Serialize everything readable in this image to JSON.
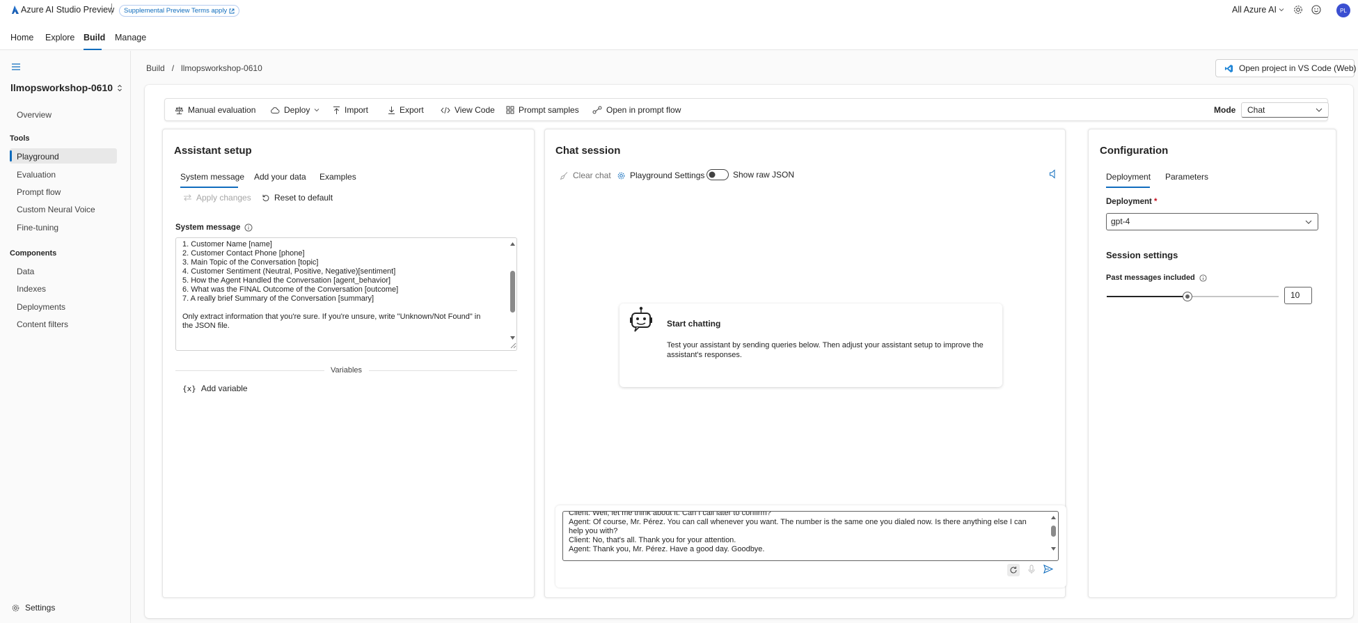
{
  "app": {
    "title": "Azure AI Studio Preview",
    "terms_badge": "Supplemental Preview Terms apply",
    "scope_selector": "All Azure AI",
    "avatar_initials": "PL",
    "accent_color": "#0f6cbd"
  },
  "nav": {
    "tabs": [
      "Home",
      "Explore",
      "Build",
      "Manage"
    ],
    "active": "Build"
  },
  "sidebar": {
    "project": "llmopsworkshop-0610",
    "overview": "Overview",
    "tools_heading": "Tools",
    "tools": [
      "Playground",
      "Evaluation",
      "Prompt flow",
      "Custom Neural Voice",
      "Fine-tuning"
    ],
    "components_heading": "Components",
    "components": [
      "Data",
      "Indexes",
      "Deployments",
      "Content filters"
    ],
    "settings": "Settings",
    "active": "Playground"
  },
  "breadcrumb": {
    "items": [
      "Build",
      "llmopsworkshop-0610"
    ],
    "separator": "/"
  },
  "header_actions": {
    "open_vscode": "Open project in VS Code (Web)"
  },
  "toolbar": {
    "manual_evaluation": "Manual evaluation",
    "deploy": "Deploy",
    "import": "Import",
    "export": "Export",
    "view_code": "View Code",
    "prompt_samples": "Prompt samples",
    "open_prompt_flow": "Open in prompt flow",
    "mode_label": "Mode",
    "mode_value": "Chat"
  },
  "assistant": {
    "title": "Assistant setup",
    "tabs": [
      "System message",
      "Add your data",
      "Examples"
    ],
    "active_tab": "System message",
    "apply_changes": "Apply changes",
    "reset_default": "Reset to default",
    "system_message_label": "System message",
    "system_message_lines": [
      "1. Customer Name [name]",
      "2. Customer Contact Phone [phone]",
      "3. Main Topic of the Conversation [topic]",
      "4. Customer Sentiment (Neutral, Positive, Negative)[sentiment]",
      "5. How the Agent Handled the Conversation [agent_behavior]",
      "6. What was the FINAL Outcome of the Conversation [outcome]",
      "7. A really brief Summary of the Conversation [summary]",
      "",
      "Only extract information that you're sure. If you're unsure, write \"Unknown/Not Found\" in",
      "the JSON file."
    ],
    "variables_label": "Variables",
    "add_variable": "Add variable"
  },
  "chat": {
    "title": "Chat session",
    "clear_chat": "Clear chat",
    "playground_settings": "Playground Settings",
    "show_raw_json": "Show raw JSON",
    "raw_json_enabled": false,
    "start_title": "Start chatting",
    "start_text_line1": "Test your assistant by sending queries below. Then adjust your assistant setup to improve the",
    "start_text_line2": "assistant's responses.",
    "input_lines": [
      "Client: Well, let me think about it. Can I call later to confirm?",
      "Agent: Of course, Mr. Pérez. You can call whenever you want. The number is the same one you dialed now. Is there anything else I can",
      "help you with?",
      "Client: No, that's all. Thank you for your attention.",
      "Agent: Thank you, Mr. Pérez. Have a good day. Goodbye."
    ]
  },
  "config": {
    "title": "Configuration",
    "tabs": [
      "Deployment",
      "Parameters"
    ],
    "active_tab": "Deployment",
    "deployment_label": "Deployment",
    "required_mark": "*",
    "deployment_value": "gpt-4",
    "session_settings": "Session settings",
    "past_messages_label": "Past messages included",
    "past_messages_value": "10",
    "past_messages_slider_fraction": 0.47
  }
}
